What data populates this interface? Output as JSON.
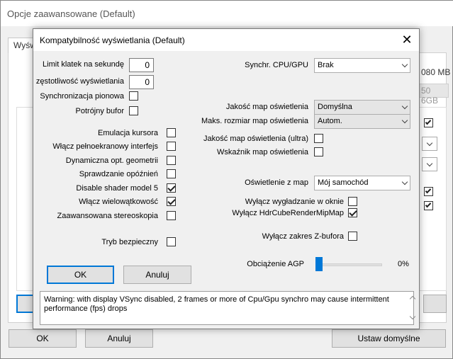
{
  "background_window": {
    "title": "Opcje zaawansowane (Default)",
    "tab_label": "Wyświetlanie",
    "memory_text": "080 MB",
    "memory_field": "50 6GB",
    "buttons": {
      "ok": "OK",
      "cancel": "Anuluj",
      "defaults": "Ustaw domyślne"
    },
    "checkboxes": [
      true,
      true,
      true
    ]
  },
  "dialog": {
    "title": "Kompatybilność wyświetlania (Default)",
    "close_glyph": "✕",
    "left": {
      "fps_limit_label": "Limit klatek na sekundę",
      "fps_limit_value": "0",
      "refresh_label": "zęstotliwość wyświetlania",
      "refresh_value": "0",
      "vsync_label": "Synchronizacja pionowa",
      "vsync_checked": false,
      "triple_buffer_label": "Potrójny bufor",
      "triple_buffer_checked": false,
      "options": [
        {
          "label": "Emulacja kursora",
          "checked": false
        },
        {
          "label": "Włącz pełnoekranowy interfejs",
          "checked": false
        },
        {
          "label": "Dynamiczna opt. geometrii",
          "checked": false
        },
        {
          "label": "Sprawdzanie opóźnień",
          "checked": false
        },
        {
          "label": "Disable shader model 5",
          "checked": true
        },
        {
          "label": "Włącz wielowątkowość",
          "checked": true
        },
        {
          "label": "Zaawansowana stereoskopia",
          "checked": false
        }
      ],
      "safe_mode_label": "Tryb bezpieczny",
      "safe_mode_checked": false
    },
    "right": {
      "cpu_gpu_sync_label": "Synchr. CPU/GPU",
      "cpu_gpu_sync_value": "Brak",
      "lightmap_quality_label": "Jakość map oświetlenia",
      "lightmap_quality_value": "Domyślna",
      "lightmap_maxsize_label": "Maks. rozmiar map oświetlenia",
      "lightmap_maxsize_value": "Autom.",
      "lightmap_ultra_label": "Jakość map oświetlenia (ultra)",
      "lightmap_ultra_checked": false,
      "lightmap_indicator_label": "Wskaźnik map oświetlenia",
      "lightmap_indicator_checked": false,
      "map_lighting_label": "Oświetlenie z map",
      "map_lighting_value": "Mój samochód",
      "disable_window_smoothing_label": "Wyłącz wygładzanie w oknie",
      "disable_window_smoothing_checked": false,
      "disable_hdrcube_label": "Wyłącz HdrCubeRenderMipMap",
      "disable_hdrcube_checked": true,
      "disable_zbuffer_label": "Wyłącz zakres Z-bufora",
      "disable_zbuffer_checked": false,
      "agp_load_label": "Obciążenie AGP",
      "agp_load_value": "0%",
      "agp_load_level": 0
    },
    "ok_label": "OK",
    "cancel_label": "Anuluj",
    "warning_text": "Warning: with display VSync disabled, 2 frames or more of Cpu/Gpu synchro may cause intermittent performance (fps) drops"
  },
  "colors": {
    "accent": "#0078d7",
    "dialog_bg": "#f0f0f0"
  }
}
